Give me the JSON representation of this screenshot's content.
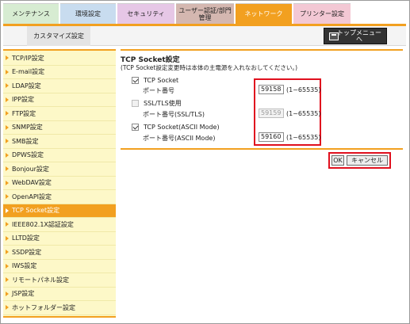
{
  "tabs": [
    {
      "label": "メンテナンス"
    },
    {
      "label": "環境設定"
    },
    {
      "label": "セキュリティ"
    },
    {
      "label": "ユーザー認証/部門\n管理"
    },
    {
      "label": "ネットワーク"
    },
    {
      "label": "プリンター設定"
    }
  ],
  "subtab": {
    "label": "カスタマイズ設定"
  },
  "top_menu": {
    "label": "トップメニュー\nへ",
    "icon": "home-menu-icon"
  },
  "nav": {
    "items": [
      {
        "label": "TCP/IP設定"
      },
      {
        "label": "E-mail設定"
      },
      {
        "label": "LDAP設定"
      },
      {
        "label": "IPP設定"
      },
      {
        "label": "FTP設定"
      },
      {
        "label": "SNMP設定"
      },
      {
        "label": "SMB設定"
      },
      {
        "label": "DPWS設定"
      },
      {
        "label": "Bonjour設定"
      },
      {
        "label": "WebDAV設定"
      },
      {
        "label": "OpenAPI設定"
      },
      {
        "label": "TCP Socket設定"
      },
      {
        "label": "IEEE802.1X認証設定"
      },
      {
        "label": "LLTD設定"
      },
      {
        "label": "SSDP設定"
      },
      {
        "label": "IWS設定"
      },
      {
        "label": "リモートパネル設定"
      },
      {
        "label": "JSP設定"
      },
      {
        "label": "ホットフォルダー設定"
      }
    ],
    "active_index": 11
  },
  "content": {
    "title": "TCP Socket設定",
    "note": "(TCP Socket設定変更時は本体の主電源を入れなおしてください。)",
    "sections": [
      {
        "check_label": "TCP Socket",
        "checked": true,
        "disabled": false,
        "port_label": "ポート番号",
        "port_value": "59158",
        "range": "(1~65535)"
      },
      {
        "check_label": "SSL/TLS使用",
        "checked": false,
        "disabled": true,
        "port_label": "ポート番号(SSL/TLS)",
        "port_value": "59159",
        "range": "(1~65535)"
      },
      {
        "check_label": "TCP Socket(ASCII Mode)",
        "checked": true,
        "disabled": false,
        "port_label": "ポート番号(ASCII Mode)",
        "port_value": "59160",
        "range": "(1~65535)"
      }
    ],
    "ok_label": "OK",
    "cancel_label": "キャンセル"
  },
  "colors": {
    "accent": "#f2a020",
    "nav_bg": "#fdf8c8",
    "highlight": "#e0101e"
  }
}
